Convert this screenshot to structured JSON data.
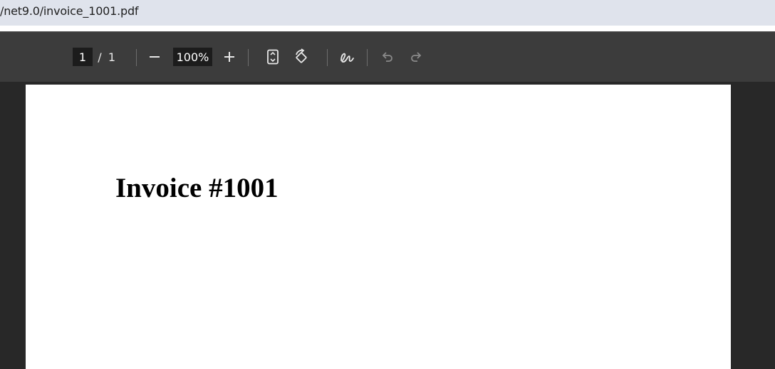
{
  "address_bar": {
    "url_text": "/net9.0/invoice_1001.pdf"
  },
  "toolbar": {
    "current_page": "1",
    "page_separator": "/",
    "total_pages": "1",
    "zoom_level": "100%",
    "icons": {
      "zoom_out": "minus-icon",
      "zoom_in": "plus-icon",
      "fit": "fit-to-page-icon",
      "rotate": "rotate-icon",
      "annotate": "draw-icon",
      "undo": "undo-icon",
      "redo": "redo-icon"
    }
  },
  "document": {
    "title": "Invoice #1001"
  },
  "colors": {
    "toolbar_bg": "#3c3c3c",
    "viewer_bg": "#282828",
    "address_bg": "#dfe3ec",
    "disabled_icon": "#8a8a8a"
  }
}
